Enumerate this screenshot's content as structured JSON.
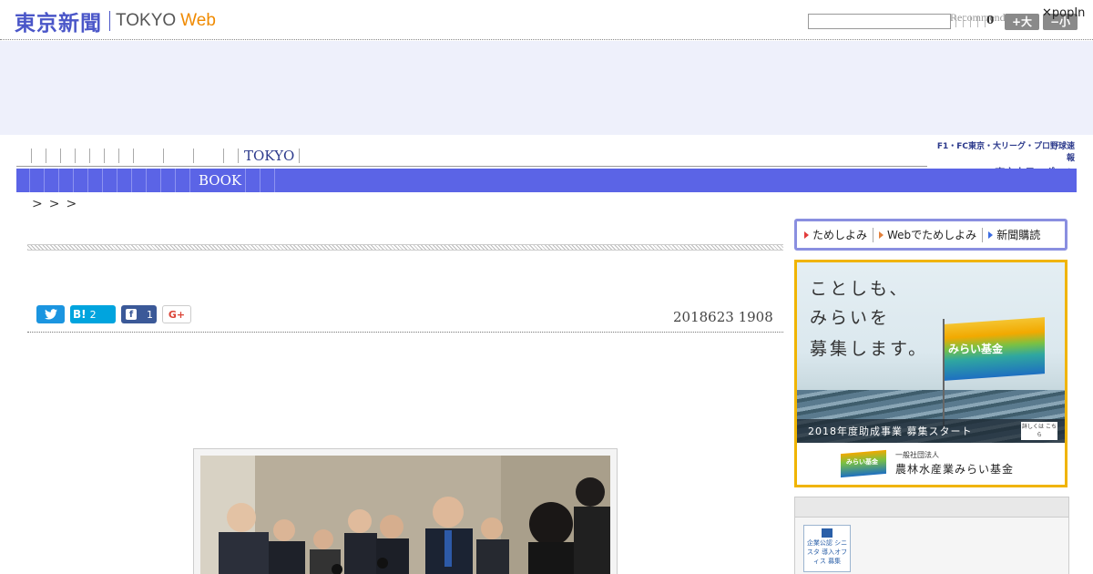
{
  "header": {
    "logo_jp": "東京新聞",
    "logo_tokyo": "TOKYO",
    "logo_web": "Web",
    "search_placeholder": "",
    "recommend_label": "Recommend",
    "count": "0",
    "size_big": "+大",
    "size_small": "−小",
    "popin": "✕popIn"
  },
  "nav": {
    "tokyo_label": "TOKYO",
    "book_label": "BOOK",
    "chunichi_line1": "F1・FC東京・大リーグ・プロ野球速報",
    "chunichi_line2": "東京中日スポーツ"
  },
  "breadcrumb": ">>>",
  "article": {
    "hatena_icon": "B!",
    "hatena_count": "2",
    "facebook_count": "1",
    "gplus_label": "G+",
    "dateline": "2018623 1908"
  },
  "sidebar": {
    "cta": [
      {
        "label": "ためしよみ",
        "icon": "arrow-red"
      },
      {
        "label": "Webでためしよみ",
        "icon": "arrow-orange"
      },
      {
        "label": "新聞購読",
        "icon": "arrow-blue"
      }
    ],
    "banner": {
      "line1": "ことしも、",
      "line2": "みらいを",
      "line3": "募集します。",
      "flag_label": "みらい基金",
      "strip_text": "2018年度助成事業 募集スタート",
      "strip_button": "詳しくは こちら",
      "foot_small": "一般社団法人",
      "foot_big": "農林水産業みらい基金",
      "foot_flag_label": "みらい基金"
    },
    "badge_text": "企業公認 シニスタ 導入オフィス 募集"
  },
  "colors": {
    "brand_blue": "#4a56c8",
    "nav_blue": "#5b64e6",
    "web_orange": "#f08a00",
    "banner_border": "#f0b400"
  }
}
